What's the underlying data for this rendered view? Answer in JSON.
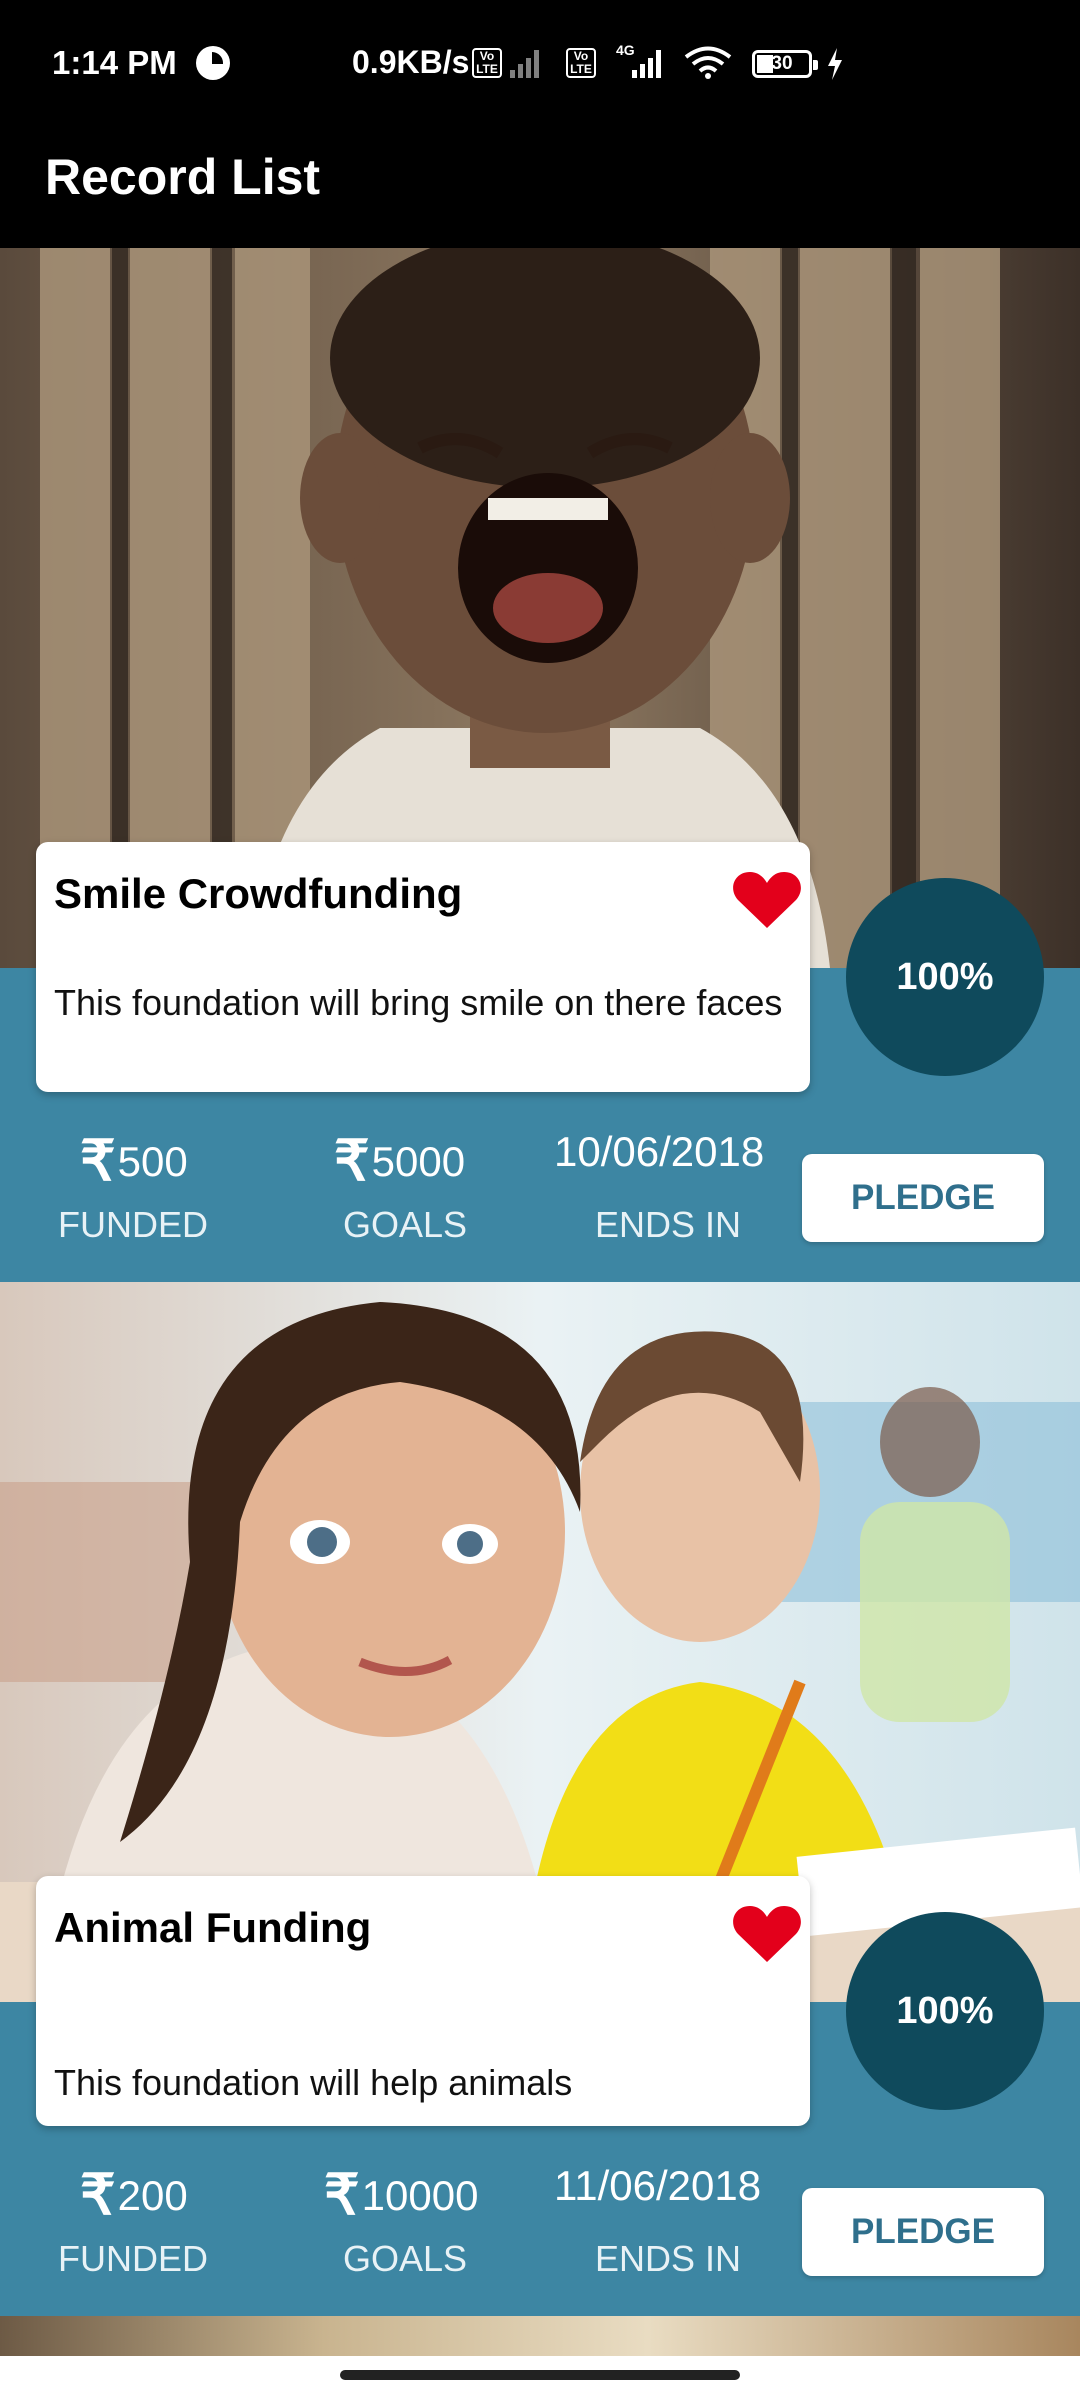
{
  "status_bar": {
    "time": "1:14 PM",
    "net_speed": "0.9KB/s",
    "volte1": "Vo LTE",
    "volte2": "Vo LTE",
    "network_type": "4G",
    "battery_level": "30",
    "icons": [
      "alarm-icon",
      "volte-icon",
      "signal-icon",
      "signal-4g-icon",
      "wifi-icon",
      "battery-icon",
      "charging-icon"
    ]
  },
  "app_bar": {
    "title": "Record List"
  },
  "campaigns": [
    {
      "title": "Smile Crowdfunding",
      "description": "This foundation will bring smile on there faces",
      "percent": "100%",
      "funded": "500",
      "goals": "5000",
      "ends_in": "10/06/2018",
      "funded_label": "FUNDED",
      "goals_label": "GOALS",
      "ends_label": "ENDS IN",
      "pledge_label": "PLEDGE",
      "favorited": true,
      "currency": "₹"
    },
    {
      "title": "Animal Funding",
      "description": "This foundation will help animals",
      "percent": "100%",
      "funded": "200",
      "goals": "10000",
      "ends_in": "11/06/2018",
      "funded_label": "FUNDED",
      "goals_label": "GOALS",
      "ends_label": "ENDS IN",
      "pledge_label": "PLEDGE",
      "favorited": true,
      "currency": "₹"
    }
  ],
  "colors": {
    "band": "#3d86a3",
    "badge": "#0f4a5c",
    "heart": "#e3001b",
    "pledge_text": "#2f6f8c"
  }
}
